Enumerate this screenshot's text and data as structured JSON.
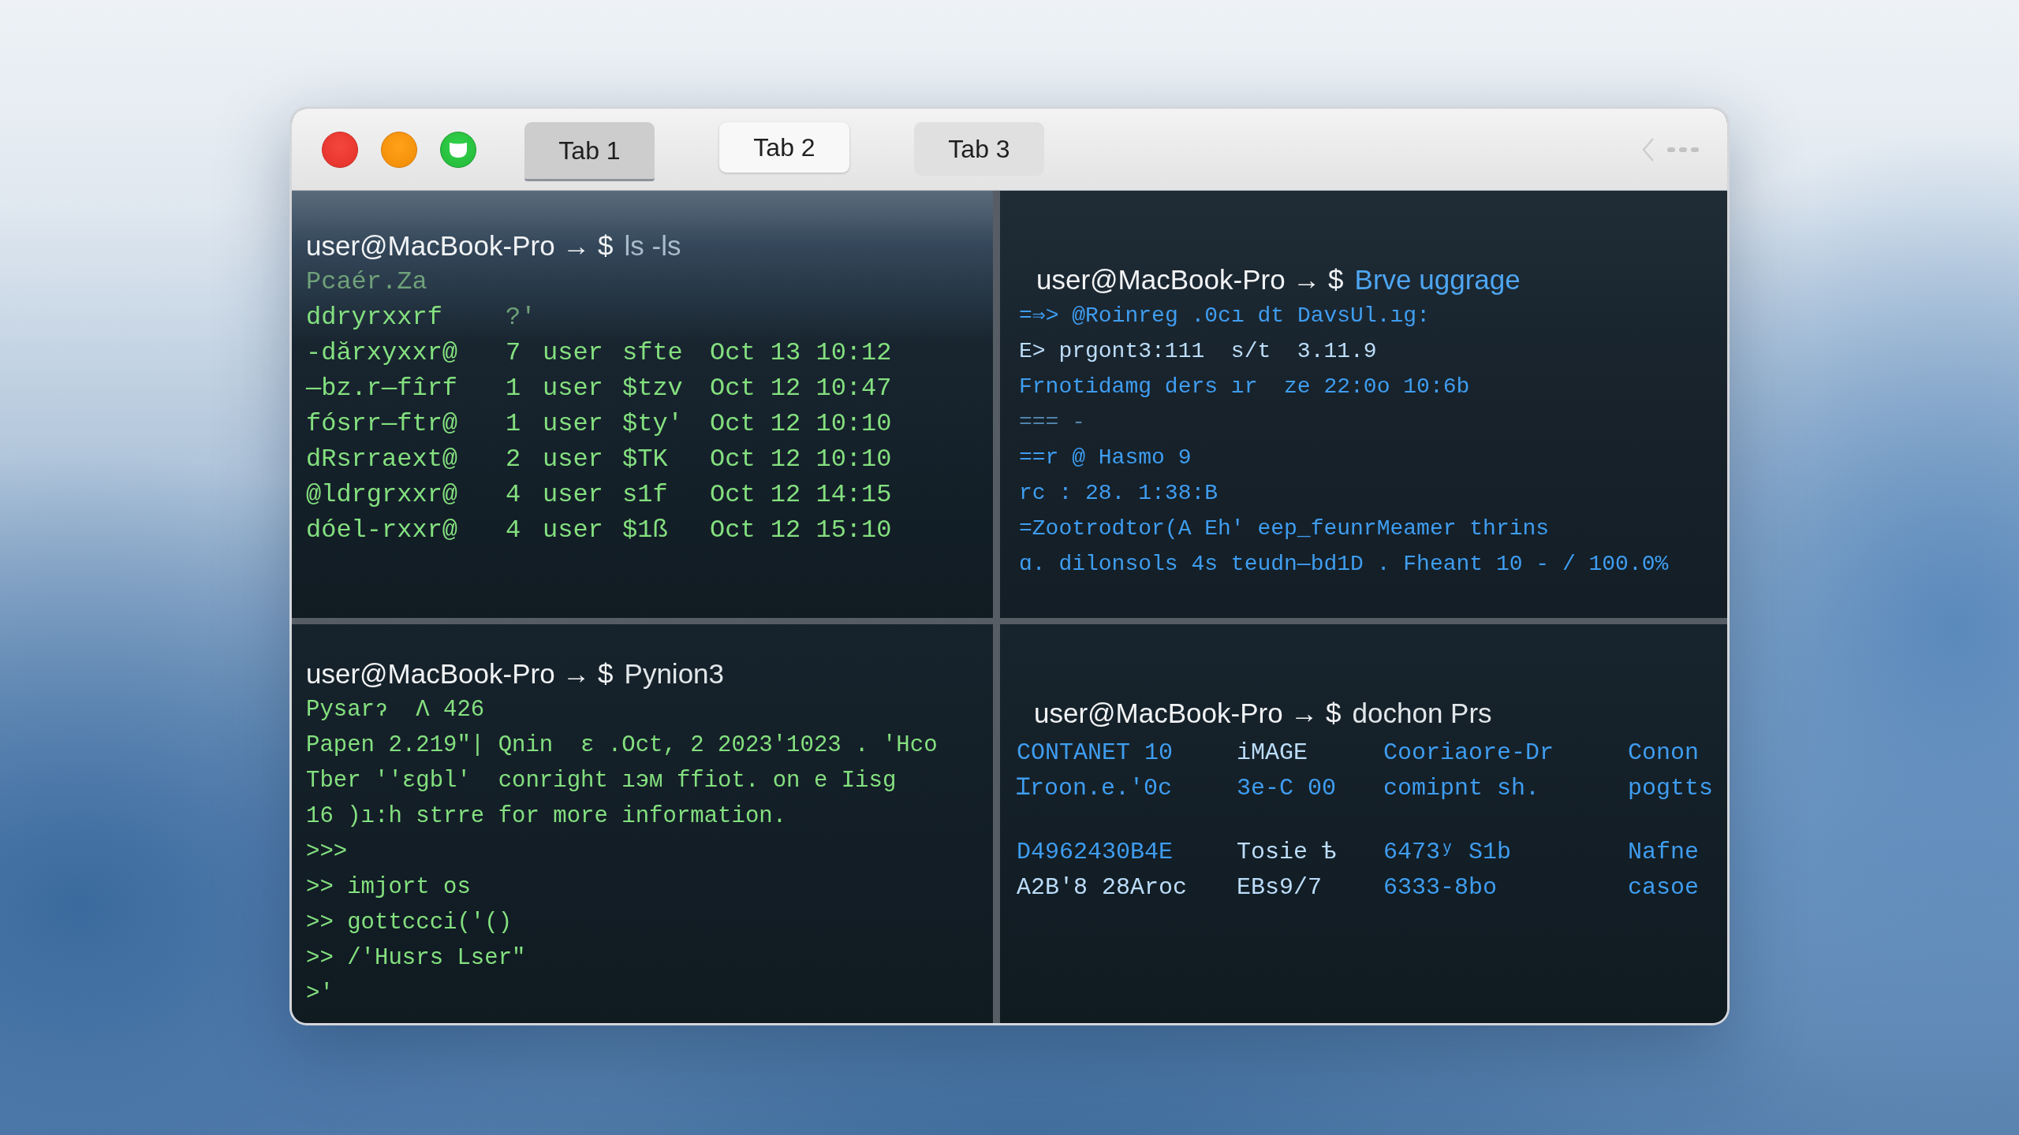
{
  "window": {
    "tabs": [
      {
        "label": "Tab 1",
        "selected": true,
        "hovered": false
      },
      {
        "label": "Tab 2",
        "selected": false,
        "hovered": true
      },
      {
        "label": "Tab 3",
        "selected": false,
        "hovered": false
      }
    ],
    "panes": [
      {
        "color": "#84e07f",
        "prompt": "user@MacBook-Pro → $",
        "command": {
          "text": "ls -ls",
          "kind": "muted"
        },
        "lines": [
          {
            "kind": "faint",
            "text": "Pcaér.Za"
          },
          {
            "kind": "columns",
            "cells": [
              {
                "text": "ddryrxxrf",
                "kind": "output"
              },
              {
                "text": "?'",
                "kind": "faint"
              }
            ]
          },
          {
            "kind": "columns",
            "cells": [
              {
                "text": "-dărxyxxr@",
                "kind": "output"
              },
              {
                "text": "7",
                "kind": "output"
              },
              {
                "text": "user",
                "kind": "output"
              },
              {
                "text": "sfte",
                "kind": "output"
              },
              {
                "text": "Oct 13 10:12",
                "kind": "output"
              }
            ]
          },
          {
            "kind": "columns",
            "cells": [
              {
                "text": "—bz.r—fîrf",
                "kind": "output"
              },
              {
                "text": "1",
                "kind": "output"
              },
              {
                "text": "user",
                "kind": "output"
              },
              {
                "text": "$tzv",
                "kind": "output"
              },
              {
                "text": "Oct 12 10:47",
                "kind": "output"
              }
            ]
          },
          {
            "kind": "columns",
            "cells": [
              {
                "text": "fósrr—ftr@",
                "kind": "output"
              },
              {
                "text": "1",
                "kind": "output"
              },
              {
                "text": "user",
                "kind": "output"
              },
              {
                "text": "$ty'",
                "kind": "output"
              },
              {
                "text": "Oct 12 10:10",
                "kind": "output"
              }
            ]
          },
          {
            "kind": "columns",
            "cells": [
              {
                "text": "dRsrraext@",
                "kind": "output"
              },
              {
                "text": "2",
                "kind": "output"
              },
              {
                "text": "user",
                "kind": "output"
              },
              {
                "text": "$TK",
                "kind": "output"
              },
              {
                "text": "Oct 12 10:10",
                "kind": "output"
              }
            ]
          },
          {
            "kind": "columns",
            "cells": [
              {
                "text": "@ldrgrxxr@",
                "kind": "output"
              },
              {
                "text": "4",
                "kind": "output"
              },
              {
                "text": "user",
                "kind": "output"
              },
              {
                "text": "s1f",
                "kind": "output"
              },
              {
                "text": "Oct 12 14:15",
                "kind": "output"
              }
            ]
          },
          {
            "kind": "columns",
            "cells": [
              {
                "text": "dóel-rxxr@",
                "kind": "output"
              },
              {
                "text": "4",
                "kind": "output"
              },
              {
                "text": "user",
                "kind": "output"
              },
              {
                "text": "$1ß",
                "kind": "output"
              },
              {
                "text": "Oct 12 15:10",
                "kind": "output"
              }
            ]
          }
        ]
      },
      {
        "color": "#3f9df0",
        "prompt": "user@MacBook-Pro → $",
        "command": {
          "text": "Brve uggrage",
          "kind": "accent"
        },
        "lines": [
          {
            "kind": "output",
            "text": "=⇒> @Roinreg .0cı dt DavsUl.ıg:"
          },
          {
            "kind": "highlight",
            "text": "E> prgont3:111  s/t  3.11.9"
          },
          {
            "kind": "output",
            "text": "Frnotidamg ders ır  ze 22:0o 10:6b"
          },
          {
            "kind": "faint",
            "text": "=== -"
          },
          {
            "kind": "output",
            "text": "==r @ Hasmo 9"
          },
          {
            "kind": "output",
            "text": "rc : 28. 1:38:B"
          },
          {
            "kind": "output",
            "text": "=Zootrodtor(A Eh' eep_feunrMeamer thrins"
          },
          {
            "kind": "output",
            "text": "ɑ. dilonsols 4s teudn—bd1D . Fheant 10 - / 100.0%"
          }
        ]
      },
      {
        "color": "#84e07f",
        "prompt": "user@MacBook-Pro → $",
        "command": {
          "text": "Pynion3",
          "kind": "plain"
        },
        "lines": [
          {
            "kind": "output",
            "text": "Pysarɂ  Λ 426"
          },
          {
            "kind": "output",
            "text": "Papen 2.219\"| Qnin  ɛ .Oct, 2 2023'1023 . 'Hco"
          },
          {
            "kind": "output",
            "text": "Tber ''ɛgbl'  conright ıэм ffiot. on e Iisg"
          },
          {
            "kind": "output",
            "text": "16 )ı:h strre for more information."
          },
          {
            "kind": "output",
            "text": ">>>"
          },
          {
            "kind": "output",
            "text": ">> imjort os"
          },
          {
            "kind": "output",
            "text": ">> gottccci('()"
          },
          {
            "kind": "output",
            "text": ">> /'Husrs Lser\""
          },
          {
            "kind": "output",
            "text": ">'"
          }
        ]
      },
      {
        "color": "#3f9df0",
        "prompt": "user@MacBook-Pro → $",
        "command": {
          "text": "dochon Prs",
          "kind": "plain"
        },
        "lines": [
          {
            "kind": "columns",
            "cells": [
              {
                "text": "CONTANET 10",
                "kind": "output"
              },
              {
                "text": "iMAGE",
                "kind": "highlight"
              },
              {
                "text": "Cooriaore-Dr",
                "kind": "output"
              },
              {
                "text": "Conon",
                "kind": "output"
              }
            ]
          },
          {
            "kind": "columns",
            "cells": [
              {
                "text": "Ɪroon.e.'0c",
                "kind": "output"
              },
              {
                "text": "3e-C 00",
                "kind": "output"
              },
              {
                "text": "comipnt sh.",
                "kind": "output"
              },
              {
                "text": "pogtts",
                "kind": "output"
              }
            ]
          },
          {
            "kind": "blank"
          },
          {
            "kind": "columns",
            "cells": [
              {
                "text": "D4962430B4E",
                "kind": "output"
              },
              {
                "text": "Tosie ѣ",
                "kind": "highlight"
              },
              {
                "text": "6473ʸ S1b",
                "kind": "output"
              },
              {
                "text": "Nafne",
                "kind": "output"
              }
            ]
          },
          {
            "kind": "columns",
            "cells": [
              {
                "text": "A2B'8 28Aroc",
                "kind": "highlight"
              },
              {
                "text": "EBs9/7",
                "kind": "highlight"
              },
              {
                "text": "6333-8bo",
                "kind": "output"
              },
              {
                "text": "casoe",
                "kind": "output"
              }
            ]
          }
        ]
      }
    ]
  }
}
